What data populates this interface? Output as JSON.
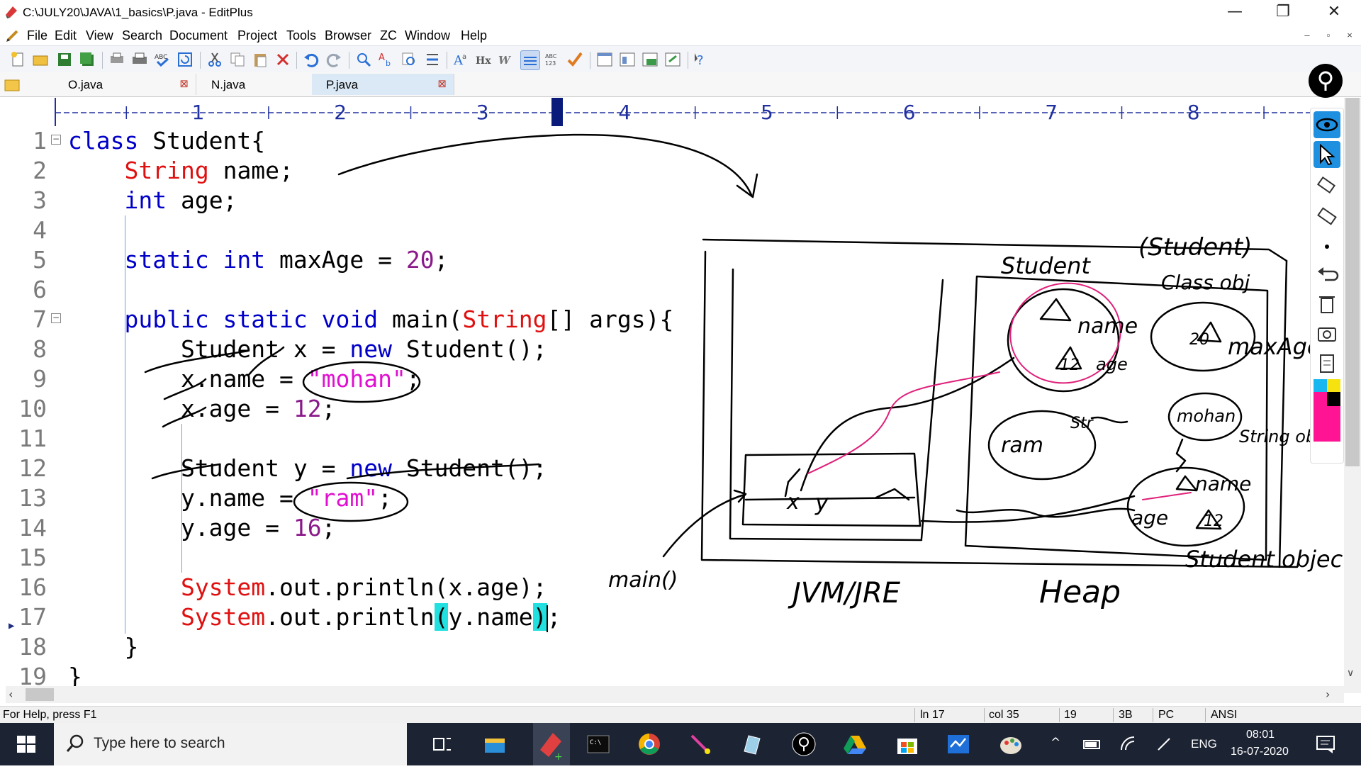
{
  "window": {
    "title": "C:\\JULY20\\JAVA\\1_basics\\P.java - EditPlus",
    "minimize": "—",
    "restore": "❐",
    "close": "✕"
  },
  "menu": {
    "items": [
      "File",
      "Edit",
      "View",
      "Search",
      "Document",
      "Project",
      "Tools",
      "Browser",
      "ZC",
      "Window",
      "Help"
    ]
  },
  "tabs": [
    {
      "label": "O.java",
      "active": false
    },
    {
      "label": "N.java",
      "active": false
    },
    {
      "label": "P.java",
      "active": true
    }
  ],
  "ruler": {
    "labels": [
      "1",
      "2",
      "3",
      "4",
      "5",
      "6",
      "7",
      "8"
    ]
  },
  "editor": {
    "lines": [
      {
        "n": "1",
        "tokens": [
          [
            "kw",
            "class"
          ],
          [
            "pl",
            " Student{"
          ]
        ]
      },
      {
        "n": "2",
        "tokens": [
          [
            "pl",
            "    "
          ],
          [
            "ty",
            "String"
          ],
          [
            "pl",
            " name;"
          ]
        ]
      },
      {
        "n": "3",
        "tokens": [
          [
            "pl",
            "    "
          ],
          [
            "kw",
            "int"
          ],
          [
            "pl",
            " age;"
          ]
        ]
      },
      {
        "n": "4",
        "tokens": [
          [
            "pl",
            ""
          ]
        ]
      },
      {
        "n": "5",
        "tokens": [
          [
            "pl",
            "    "
          ],
          [
            "kw",
            "static int"
          ],
          [
            "pl",
            " maxAge = "
          ],
          [
            "num",
            "20"
          ],
          [
            "pl",
            ";"
          ]
        ]
      },
      {
        "n": "6",
        "tokens": [
          [
            "pl",
            ""
          ]
        ]
      },
      {
        "n": "7",
        "tokens": [
          [
            "pl",
            "    "
          ],
          [
            "kw",
            "public static void"
          ],
          [
            "pl",
            " main("
          ],
          [
            "ty",
            "String"
          ],
          [
            "pl",
            "[] args){"
          ]
        ]
      },
      {
        "n": "8",
        "tokens": [
          [
            "pl",
            "        Student x = "
          ],
          [
            "kw",
            "new"
          ],
          [
            "pl",
            " Student();"
          ]
        ]
      },
      {
        "n": "9",
        "tokens": [
          [
            "pl",
            "        x.name = "
          ],
          [
            "str",
            "\"mohan\""
          ],
          [
            "pl",
            ";"
          ]
        ]
      },
      {
        "n": "10",
        "tokens": [
          [
            "pl",
            "        x.age = "
          ],
          [
            "num",
            "12"
          ],
          [
            "pl",
            ";"
          ]
        ]
      },
      {
        "n": "11",
        "tokens": [
          [
            "pl",
            ""
          ]
        ]
      },
      {
        "n": "12",
        "tokens": [
          [
            "pl",
            "        Student y = "
          ],
          [
            "kw",
            "new"
          ],
          [
            "pl",
            " Student();"
          ]
        ]
      },
      {
        "n": "13",
        "tokens": [
          [
            "pl",
            "        y.name = "
          ],
          [
            "str",
            "\"ram\""
          ],
          [
            "pl",
            ";"
          ]
        ]
      },
      {
        "n": "14",
        "tokens": [
          [
            "pl",
            "        y.age = "
          ],
          [
            "num",
            "16"
          ],
          [
            "pl",
            ";"
          ]
        ]
      },
      {
        "n": "15",
        "tokens": [
          [
            "pl",
            ""
          ]
        ]
      },
      {
        "n": "16",
        "tokens": [
          [
            "pl",
            "        "
          ],
          [
            "ty",
            "System"
          ],
          [
            "pl",
            ".out.println(x.age);"
          ]
        ]
      },
      {
        "n": "17",
        "tokens": [
          [
            "pl",
            "        "
          ],
          [
            "ty",
            "System"
          ],
          [
            "pl",
            ".out.println"
          ],
          [
            "hl",
            "("
          ],
          [
            "pl",
            "y.name"
          ],
          [
            "hl",
            ")"
          ],
          [
            "pl",
            ";"
          ]
        ]
      },
      {
        "n": "18",
        "tokens": [
          [
            "pl",
            "    }"
          ]
        ]
      },
      {
        "n": "19",
        "tokens": [
          [
            "pl",
            "}"
          ]
        ]
      }
    ]
  },
  "annotations": {
    "student_title": "(Student)",
    "student_label": "Student",
    "class_obj": "Class obj",
    "name": "name",
    "age": "age",
    "val_12": "12",
    "val_20": "20",
    "maxage": "maxAge",
    "mohan": "mohan",
    "ram": "ram",
    "string_obj": "String obj",
    "str": "Str",
    "name2": "name",
    "age2": "age",
    "val_12b": "12",
    "student_object": "Student object",
    "main": "main()",
    "jvm": "JVM/JRE",
    "heap": "Heap",
    "x": "x",
    "y": "y"
  },
  "statusbar": {
    "help": "For Help, press F1",
    "ln": "ln 17",
    "col": "col 35",
    "n19": "19",
    "n3b": "3B",
    "pc": "PC",
    "enc": "ANSI"
  },
  "taskbar": {
    "search_placeholder": "Type here to search",
    "lang": "ENG",
    "time": "08:01",
    "date": "16-07-2020"
  }
}
